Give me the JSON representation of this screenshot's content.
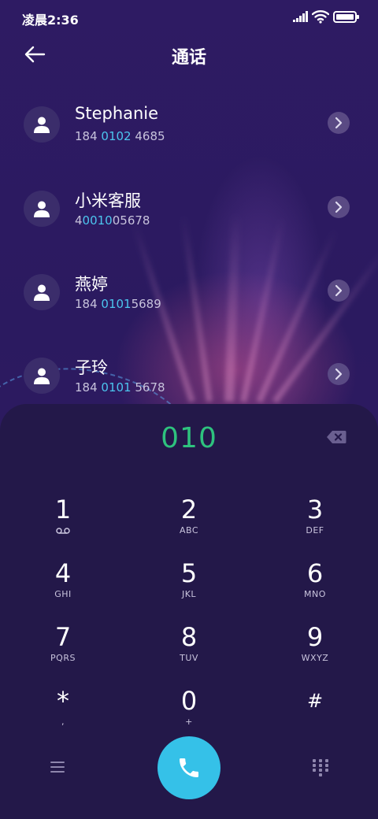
{
  "status_bar": {
    "time": "凌晨2:36"
  },
  "header": {
    "title": "通话",
    "back_icon": "arrow-left-icon"
  },
  "contacts": [
    {
      "name": "Stephanie",
      "number_pre": "184 ",
      "number_match": "0102",
      "number_post": " 4685"
    },
    {
      "name": "小米客服",
      "number_pre": "4",
      "number_match": "0010",
      "number_post": "05678"
    },
    {
      "name": "燕婷",
      "number_pre": "184 ",
      "number_match": "0101",
      "number_post": "5689"
    },
    {
      "name": "子玲",
      "number_pre": "184 ",
      "number_match": "0101",
      "number_post": " 5678"
    }
  ],
  "dialer": {
    "entered": "010",
    "keys": [
      {
        "digit": "1",
        "letters": ""
      },
      {
        "digit": "2",
        "letters": "ABC"
      },
      {
        "digit": "3",
        "letters": "DEF"
      },
      {
        "digit": "4",
        "letters": "GHI"
      },
      {
        "digit": "5",
        "letters": "JKL"
      },
      {
        "digit": "6",
        "letters": "MNO"
      },
      {
        "digit": "7",
        "letters": "PQRS"
      },
      {
        "digit": "8",
        "letters": "TUV"
      },
      {
        "digit": "9",
        "letters": "WXYZ"
      },
      {
        "digit": "*",
        "letters": ","
      },
      {
        "digit": "0",
        "letters": "+"
      },
      {
        "digit": "#",
        "letters": ""
      }
    ]
  },
  "colors": {
    "accent_green": "#2ec27e",
    "match_blue": "#4cc5ee",
    "call_button": "#35c1e8",
    "panel": "#231849"
  }
}
